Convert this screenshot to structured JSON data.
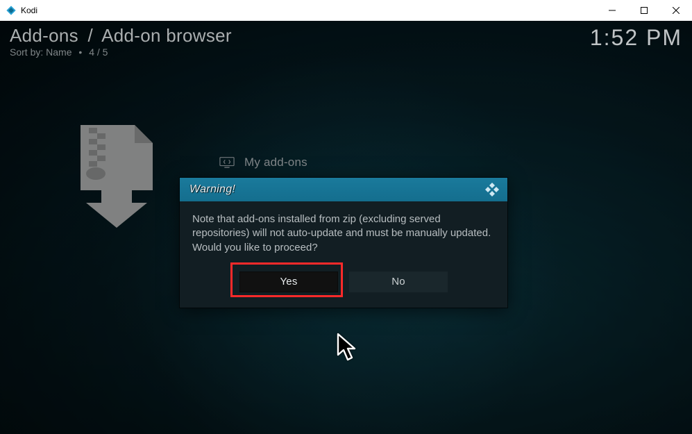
{
  "window": {
    "title": "Kodi"
  },
  "header": {
    "breadcrumb": {
      "root": "Add-ons",
      "current": "Add-on browser"
    },
    "sort_label": "Sort by:",
    "sort_value": "Name",
    "position": "4 / 5",
    "clock": "1:52 PM"
  },
  "menu": {
    "item1": "My add-ons"
  },
  "dialog": {
    "title": "Warning!",
    "body": "Note that add-ons installed from zip (excluding served repositories) will not auto-update and must be manually updated. Would you like to proceed?",
    "yes": "Yes",
    "no": "No"
  },
  "highlight": {
    "target": "yes-button"
  }
}
